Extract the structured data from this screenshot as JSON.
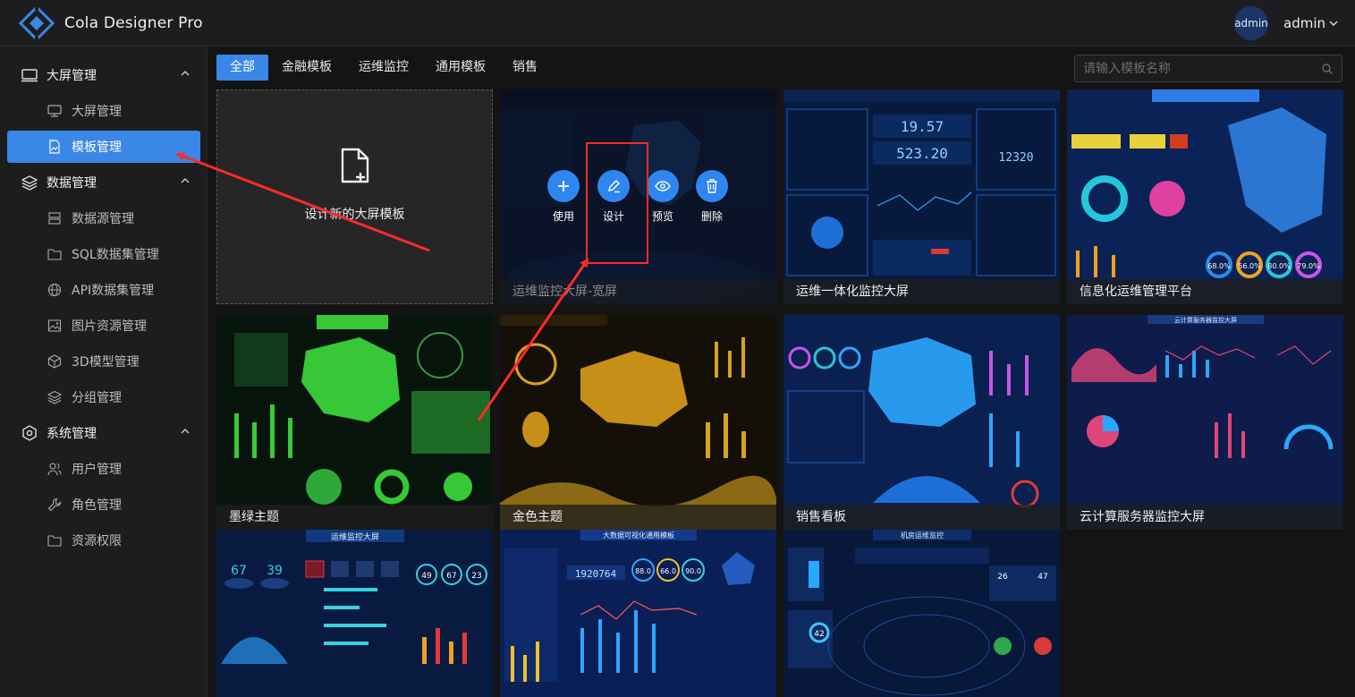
{
  "app": {
    "title": "Cola Designer Pro"
  },
  "user": {
    "avatar_text": "admin",
    "name": "admin",
    "caret": "⌄"
  },
  "sidebar": {
    "groups": [
      {
        "label": "大屏管理",
        "icon": "monitor-icon",
        "items": [
          {
            "label": "大屏管理",
            "icon": "desktop-icon",
            "active": false
          },
          {
            "label": "模板管理",
            "icon": "image-file-icon",
            "active": true
          }
        ]
      },
      {
        "label": "数据管理",
        "icon": "layers-icon",
        "items": [
          {
            "label": "数据源管理",
            "icon": "server-icon",
            "active": false
          },
          {
            "label": "SQL数据集管理",
            "icon": "folder-icon",
            "active": false
          },
          {
            "label": "API数据集管理",
            "icon": "globe-icon",
            "active": false
          },
          {
            "label": "图片资源管理",
            "icon": "picture-icon",
            "active": false
          },
          {
            "label": "3D模型管理",
            "icon": "cube-icon",
            "active": false
          },
          {
            "label": "分组管理",
            "icon": "layers-icon",
            "active": false
          }
        ]
      },
      {
        "label": "系统管理",
        "icon": "gear-icon",
        "items": [
          {
            "label": "用户管理",
            "icon": "users-icon",
            "active": false
          },
          {
            "label": "角色管理",
            "icon": "wrench-icon",
            "active": false
          },
          {
            "label": "资源权限",
            "icon": "folder-icon",
            "active": false
          }
        ]
      }
    ]
  },
  "tabs": [
    {
      "label": "全部",
      "active": true
    },
    {
      "label": "金融模板",
      "active": false
    },
    {
      "label": "运维监控",
      "active": false
    },
    {
      "label": "通用模板",
      "active": false
    },
    {
      "label": "销售",
      "active": false
    }
  ],
  "search": {
    "placeholder": "请输入模板名称",
    "value": ""
  },
  "new_template": {
    "label": "设计新的大屏模板"
  },
  "overlay_actions": [
    {
      "label": "使用",
      "icon": "plus-icon"
    },
    {
      "label": "设计",
      "icon": "edit-icon"
    },
    {
      "label": "预览",
      "icon": "eye-icon"
    },
    {
      "label": "删除",
      "icon": "trash-icon"
    }
  ],
  "templates": [
    {
      "title": "运维监控大屏-宽屏",
      "theme": "#0d1f45",
      "accent": "#2b6fd0"
    },
    {
      "title": "运维一体化监控大屏",
      "theme": "#071a3e",
      "accent": "#1e90ff"
    },
    {
      "title": "信息化运维管理平台",
      "theme": "#0a2255",
      "accent": "#3fa2ff"
    },
    {
      "title": "墨绿主题",
      "theme": "#06140c",
      "accent": "#37c837"
    },
    {
      "title": "金色主题",
      "theme": "#141008",
      "accent": "#d9a21b"
    },
    {
      "title": "销售看板",
      "theme": "#0a2050",
      "accent": "#2aa7ff"
    },
    {
      "title": "云计算服务器监控大屏",
      "theme": "#0d1c4a",
      "accent": "#e0457a"
    },
    {
      "title": "",
      "theme": "#081a40",
      "accent": "#34d3e0"
    },
    {
      "title": "",
      "theme": "#0a1f55",
      "accent": "#f0c030"
    },
    {
      "title": "",
      "theme": "#07183a",
      "accent": "#3ec6ff"
    }
  ],
  "thumbnail_text": {
    "t1_header": "运维监控大屏",
    "t1_digits": [
      "19.57",
      "523.20",
      "12320"
    ],
    "t2_percents": [
      "68.0%",
      "56.0%",
      "80.0%",
      "79.0%"
    ],
    "t6_header": "云计算服务器监控大屏",
    "t7_header": "运维监控大屏",
    "t7_nums": [
      "67",
      "39",
      "49",
      "67",
      "23"
    ],
    "t8_header": "大数据可视化通用模板",
    "t8_digits": "1920764",
    "t8_gauges": [
      "88.0",
      "66.0",
      "90.0"
    ],
    "t9_header": "机房运维监控",
    "t9_nums": [
      "26",
      "47",
      "42"
    ]
  },
  "colors": {
    "primary": "#3a87e7",
    "annotation": "#ff2a2a"
  }
}
